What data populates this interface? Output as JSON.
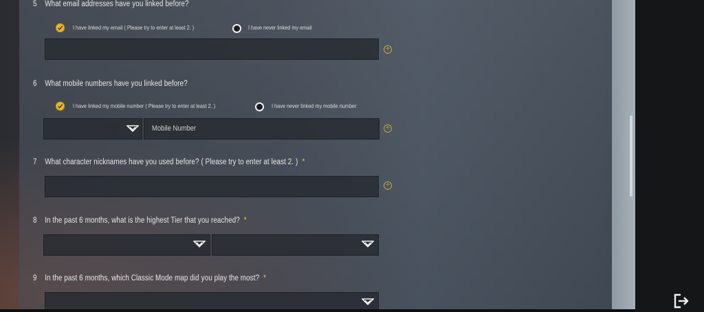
{
  "questions": [
    {
      "number": "5",
      "text": "What email addresses have you linked before?",
      "options": [
        {
          "label": "I have linked my email ( Please try to enter at least 2. )",
          "selected": true
        },
        {
          "label": "I have never linked my email",
          "selected": false
        }
      ]
    },
    {
      "number": "6",
      "text": "What mobile numbers have you linked before?",
      "options": [
        {
          "label": "I have linked my mobile number ( Please try to enter at least 2. )",
          "selected": true
        },
        {
          "label": "I have never linked my mobile number",
          "selected": false
        }
      ],
      "mobile_placeholder": "Mobile Number"
    },
    {
      "number": "7",
      "text": "What character nicknames have you used before? ( Please try to enter at least 2. )",
      "required": "*"
    },
    {
      "number": "8",
      "text": "In the past 6 months, what is the highest Tier that you reached?",
      "required": "*"
    },
    {
      "number": "9",
      "text": "In the past 6 months, which Classic Mode map did you play the most?",
      "required": "*"
    }
  ],
  "icons": {
    "add": "plus-circle-icon",
    "dropdown": "chevron-down-icon",
    "exit": "exit-icon"
  },
  "colors": {
    "accent": "#e6b52a",
    "required": "#f0c33c",
    "field": "#2a2e34"
  }
}
